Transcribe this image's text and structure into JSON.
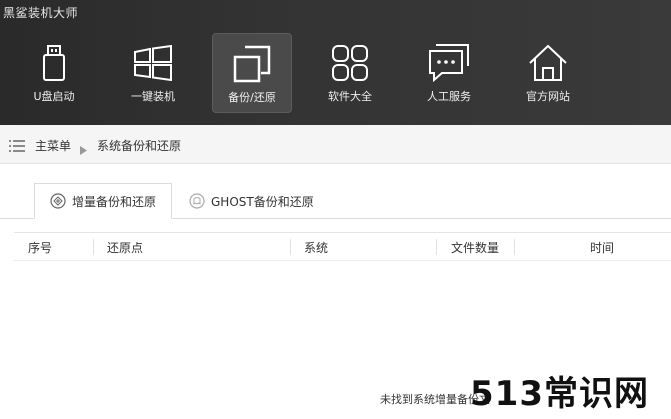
{
  "app": {
    "title": "黑鲨装机大师"
  },
  "nav": {
    "items": [
      {
        "label": "U盘启动",
        "icon": "usb-drive-icon"
      },
      {
        "label": "一键装机",
        "icon": "windows-icon"
      },
      {
        "label": "备份/还原",
        "icon": "backup-copy-icon",
        "active": true
      },
      {
        "label": "软件大全",
        "icon": "apps-grid-icon"
      },
      {
        "label": "人工服务",
        "icon": "chat-bubble-icon"
      },
      {
        "label": "官方网站",
        "icon": "home-icon"
      }
    ]
  },
  "breadcrumb": {
    "main": "主菜单",
    "current": "系统备份和还原"
  },
  "tabs": [
    {
      "label": "增量备份和还原",
      "icon": "incremental-backup-icon",
      "active": true
    },
    {
      "label": "GHOST备份和还原",
      "icon": "ghost-icon",
      "active": false
    }
  ],
  "table": {
    "columns": [
      "序号",
      "还原点",
      "系统",
      "文件数量",
      "时间"
    ]
  },
  "empty_message": "未找到系统增量备份文",
  "watermark": "513常识网",
  "colors": {
    "topbar": "#333333",
    "active_nav": "#4a4a4a",
    "nav_text": "#f0f0f0"
  }
}
